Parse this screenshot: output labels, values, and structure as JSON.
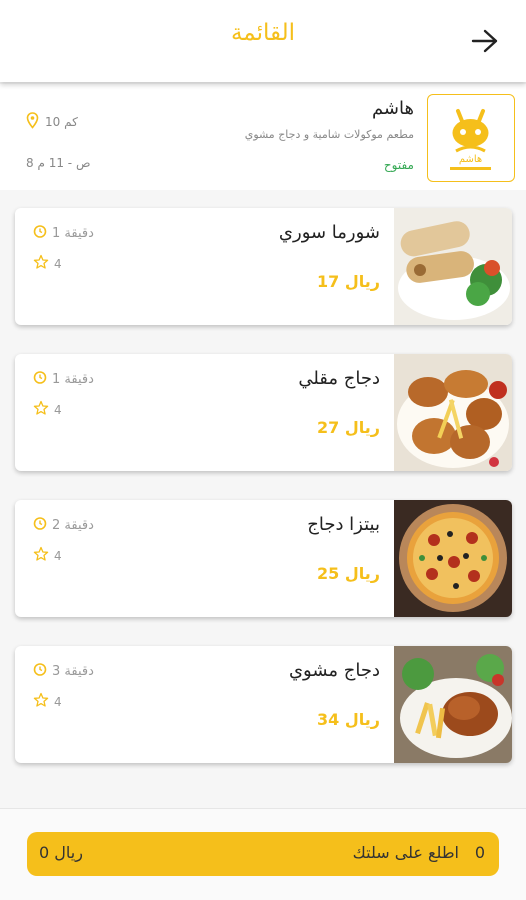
{
  "header": {
    "title": "القائمة"
  },
  "restaurant": {
    "name": "هاشم",
    "description": "مطعم موكولات شامية و دجاج مشوي",
    "status": "مفتوح",
    "distance": "10 كم",
    "hours": "8 ص - 11 م",
    "logo_text": "هاشم"
  },
  "items": [
    {
      "name": "شورما سوري",
      "price": "17 ريال",
      "time": "1 دقيقة",
      "rating": "4"
    },
    {
      "name": "دجاج مقلي",
      "price": "27 ريال",
      "time": "1 دقيقة",
      "rating": "4"
    },
    {
      "name": "بيتزا دجاج",
      "price": "25 ريال",
      "time": "2 دقيقة",
      "rating": "4"
    },
    {
      "name": "دجاج مشوي",
      "price": "34 ريال",
      "time": "3 دقيقة",
      "rating": "4"
    }
  ],
  "cart": {
    "count": "0",
    "label": "اطلع على سلتك",
    "total": "0 ريال"
  },
  "colors": {
    "accent": "#f5bf1b",
    "open": "#34a853"
  }
}
